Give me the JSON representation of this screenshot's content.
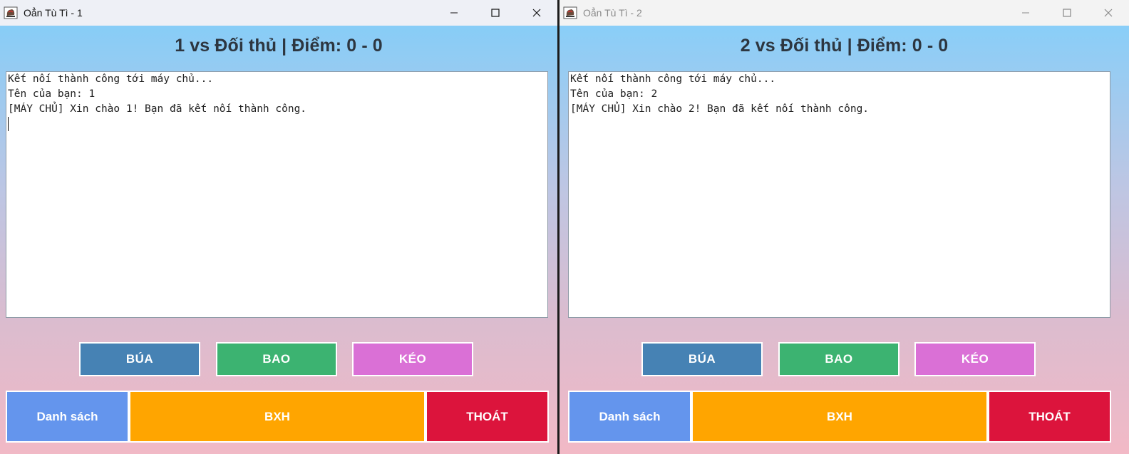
{
  "colors": {
    "bua": "#4682b4",
    "bao": "#3cb371",
    "keo": "#da70d6",
    "danh_sach": "#6495ed",
    "bxh": "#ffa500",
    "thoat": "#dc143c"
  },
  "windows": [
    {
      "title": "Oẳn Tù Tì - 1",
      "active": true,
      "header": "1 vs Đối thủ | Điểm: 0 - 0",
      "log_lines": [
        "Kết nối thành công tới máy chủ...",
        "Tên của bạn: 1",
        "[MÁY CHỦ] Xin chào 1! Bạn đã kết nối thành công."
      ],
      "buttons": {
        "bua": "BÚA",
        "bao": "BAO",
        "keo": "KÉO",
        "danh_sach": "Danh sách",
        "bxh": "BXH",
        "thoat": "THOÁT"
      }
    },
    {
      "title": "Oẳn Tù Tì - 2",
      "active": false,
      "header": "2 vs Đối thủ | Điểm: 0 - 0",
      "log_lines": [
        "Kết nối thành công tới máy chủ...",
        "Tên của bạn: 2",
        "[MÁY CHỦ] Xin chào 2! Bạn đã kết nối thành công."
      ],
      "buttons": {
        "bua": "BÚA",
        "bao": "BAO",
        "keo": "KÉO",
        "danh_sach": "Danh sách",
        "bxh": "BXH",
        "thoat": "THOÁT"
      }
    }
  ],
  "icons": {
    "app": "java-coffee-cup-icon",
    "minimize": "minimize-icon",
    "maximize": "maximize-icon",
    "close": "close-icon"
  }
}
